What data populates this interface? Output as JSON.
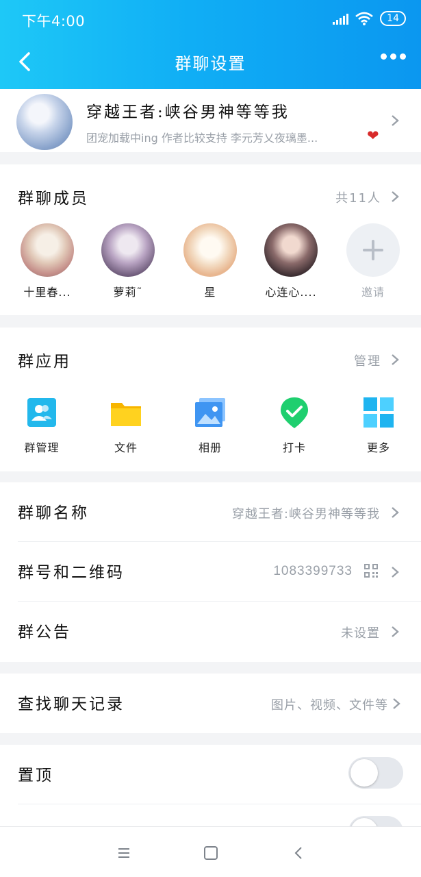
{
  "status_bar": {
    "time": "下午4:00",
    "battery": "14"
  },
  "header": {
    "title": "群聊设置"
  },
  "group": {
    "name": "穿越王者:峡谷男神等等我",
    "description": "团宠加载中ing 作者比较支持  李元芳乂夜璃墨..."
  },
  "members": {
    "title": "群聊成员",
    "count": "共11人",
    "list": [
      {
        "name": "十里春..."
      },
      {
        "name": "萝莉˜"
      },
      {
        "name": "星"
      },
      {
        "name": "心连心...."
      }
    ],
    "invite_label": "邀请"
  },
  "apps": {
    "title": "群应用",
    "manage": "管理",
    "items": [
      {
        "label": "群管理",
        "icon": "group-manage-icon"
      },
      {
        "label": "文件",
        "icon": "folder-icon"
      },
      {
        "label": "相册",
        "icon": "album-icon"
      },
      {
        "label": "打卡",
        "icon": "checkin-icon"
      },
      {
        "label": "更多",
        "icon": "more-grid-icon"
      }
    ]
  },
  "settings": {
    "group_name_label": "群聊名称",
    "group_name_value": "穿越王者:峡谷男神等等我",
    "group_id_label": "群号和二维码",
    "group_id_value": "1083399733",
    "notice_label": "群公告",
    "notice_value": "未设置",
    "search_label": "查找聊天记录",
    "search_value": "图片、视频、文件等"
  },
  "toggles": {
    "pin_label": "置顶",
    "pin_on": false,
    "second_on": false
  },
  "colors": {
    "header_start": "#1ec8f7",
    "header_end": "#0b97f0",
    "secondary_text": "#9aa0a8",
    "heart": "#d82b2b"
  }
}
